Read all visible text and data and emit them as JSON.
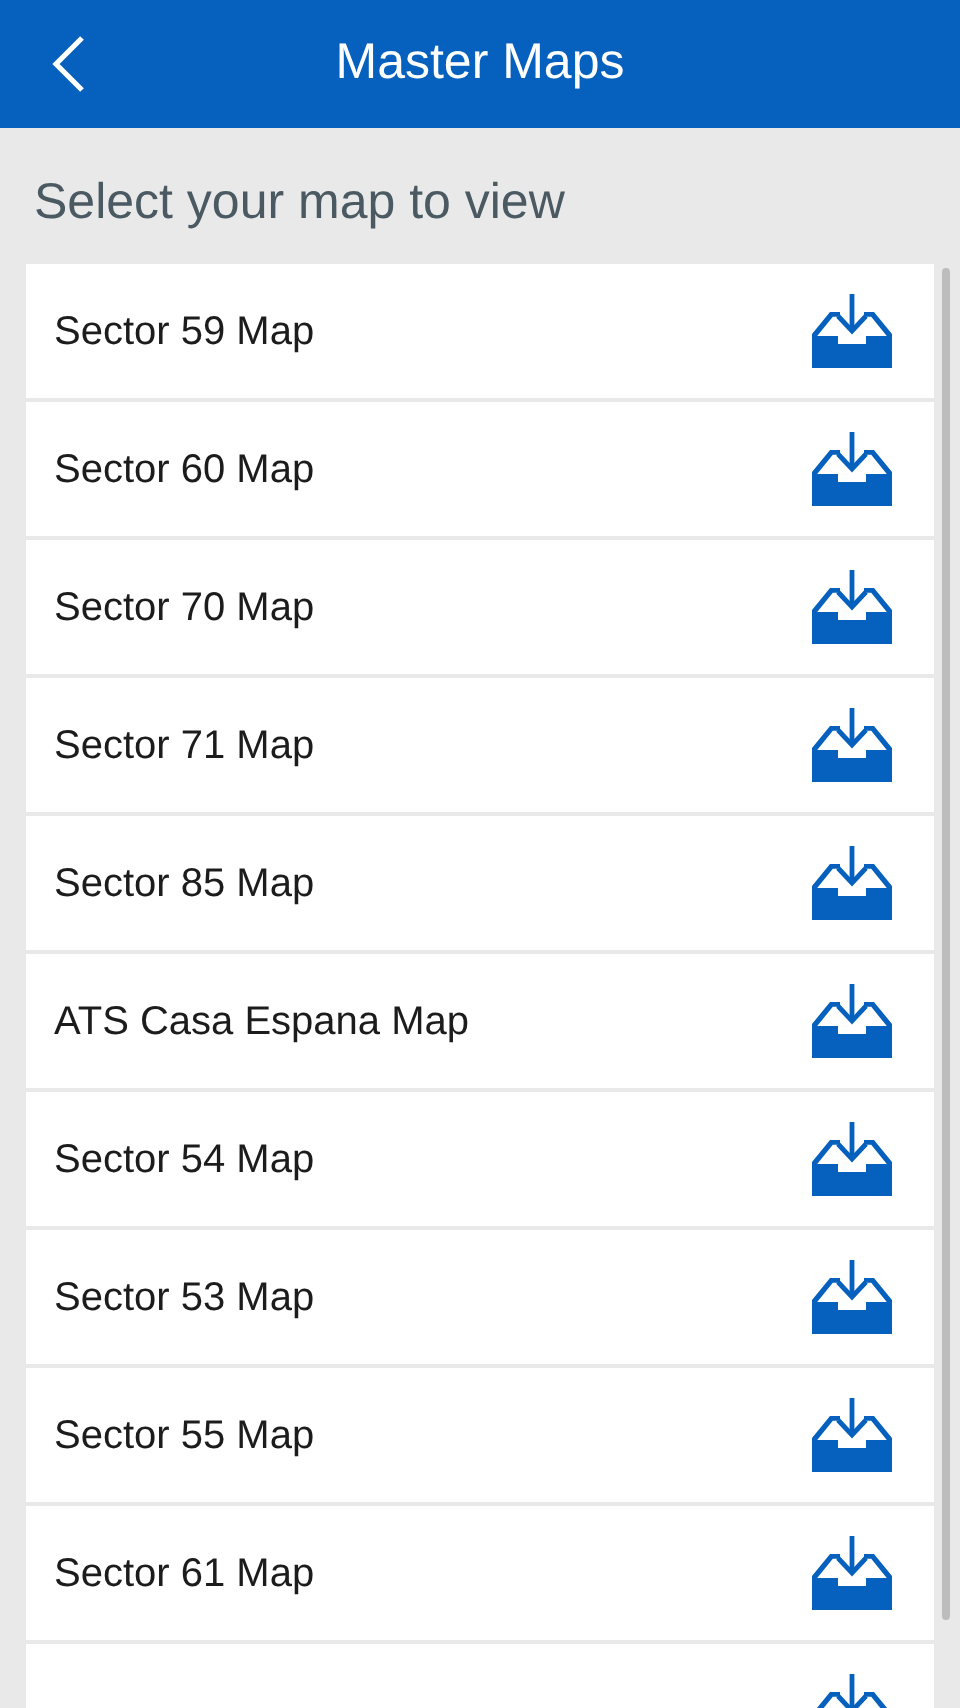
{
  "header": {
    "title": "Master Maps"
  },
  "subtitle": "Select your map to view",
  "maps": [
    {
      "label": "Sector 59 Map"
    },
    {
      "label": "Sector 60 Map"
    },
    {
      "label": "Sector 70 Map"
    },
    {
      "label": "Sector 71 Map"
    },
    {
      "label": "Sector 85 Map"
    },
    {
      "label": "ATS Casa Espana Map"
    },
    {
      "label": "Sector 54 Map"
    },
    {
      "label": "Sector 53 Map"
    },
    {
      "label": "Sector 55 Map"
    },
    {
      "label": "Sector 61 Map"
    }
  ]
}
